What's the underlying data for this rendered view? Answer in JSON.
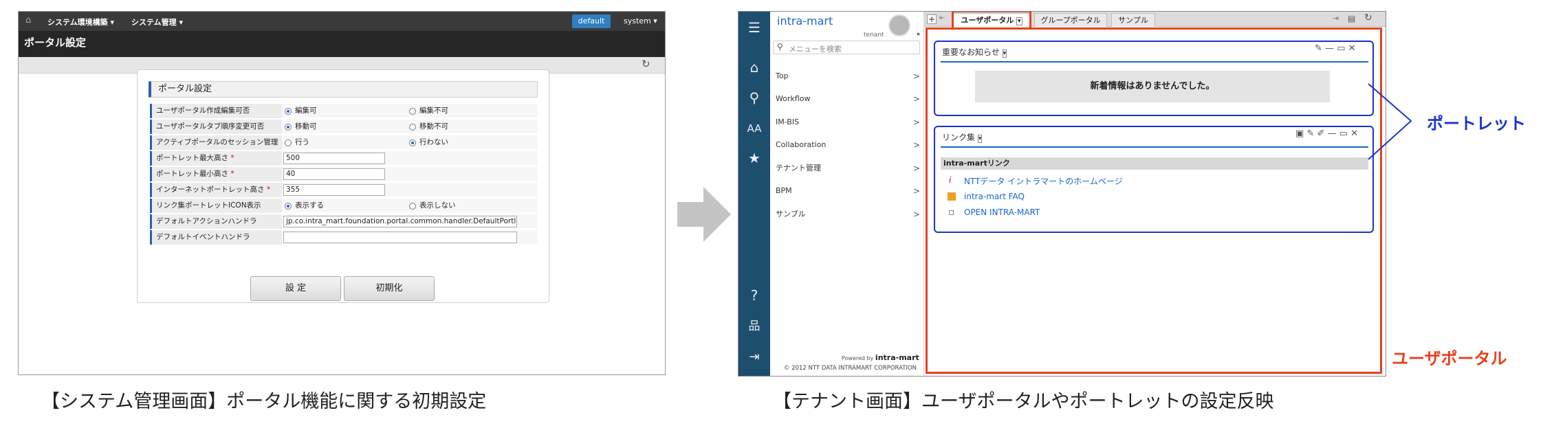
{
  "left": {
    "top_menu": [
      "システム環境構築",
      "システム管理"
    ],
    "theme_button": "default",
    "user_menu": "system",
    "page_title": "ポータル設定",
    "panel_title": "ポータル設定",
    "rows": [
      {
        "label": "ユーザポータル作成編集可否",
        "type": "radio",
        "options": [
          "編集可",
          "編集不可"
        ],
        "selected": 0
      },
      {
        "label": "ユーザポータルタブ順序変更可否",
        "type": "radio",
        "options": [
          "移動可",
          "移動不可"
        ],
        "selected": 0
      },
      {
        "label": "アクティブポータルのセッション管理",
        "type": "radio",
        "options": [
          "行う",
          "行わない"
        ],
        "selected": 1
      },
      {
        "label": "ポートレット最大高さ",
        "required": "*",
        "type": "text",
        "value": "500"
      },
      {
        "label": "ポートレット最小高さ",
        "required": "*",
        "type": "text",
        "value": "40"
      },
      {
        "label": "インターネットポートレット高さ",
        "required": "*",
        "type": "text",
        "value": "355"
      },
      {
        "label": "リンク集ポートレットICON表示",
        "type": "radio",
        "options": [
          "表示する",
          "表示しない"
        ],
        "selected": 0
      },
      {
        "label": "デフォルトアクションハンドラ",
        "type": "wide",
        "value": "jp.co.intra_mart.foundation.portal.common.handler.DefaultPortle"
      },
      {
        "label": "デフォルトイベントハンドラ",
        "type": "wide",
        "value": ""
      }
    ],
    "buttons": {
      "submit": "設 定",
      "reset": "初期化"
    }
  },
  "right": {
    "brand": "intra-mart",
    "tenant_label": "tenant",
    "search_placeholder": "メニューを検索",
    "menu_items": [
      "Top",
      "Workflow",
      "IM-BIS",
      "Collaboration",
      "テナント管理",
      "BPM",
      "サンプル"
    ],
    "powered_by": "Powered by",
    "powered_logo": "intra-mart",
    "copyright": "© 2012 NTT DATA INTRAMART CORPORATION",
    "tabs": [
      "ユーザポータル",
      "グループポータル",
      "サンプル"
    ],
    "portlet_news": {
      "title": "重要なお知らせ",
      "message": "新着情報はありませんでした。"
    },
    "portlet_links": {
      "title": "リンク集",
      "group": "intra-martリンク",
      "links": [
        "NTTデータ イントラマートのホームページ",
        "intra-mart FAQ",
        "OPEN INTRA-MART"
      ]
    },
    "callout_portlet": "ポートレット",
    "callout_user_portal": "ユーザポータル"
  },
  "captions": {
    "left": "【システム管理画面】ポータル機能に関する初期設定",
    "right": "【テナント画面】ユーザポータルやポートレットの設定反映"
  },
  "colors": {
    "accent_blue": "#1a33cc",
    "accent_red": "#e8401c",
    "sidebar": "#1e4e6e"
  }
}
